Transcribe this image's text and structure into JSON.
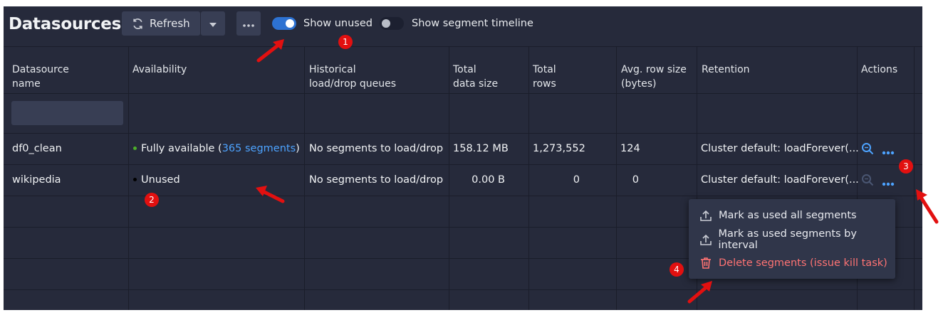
{
  "header": {
    "title": "Datasources",
    "refresh_label": "Refresh",
    "show_unused_label": "Show unused",
    "show_unused_on": true,
    "show_timeline_label": "Show segment timeline",
    "show_timeline_on": false
  },
  "table": {
    "columns": {
      "name_l1": "Datasource",
      "name_l2": "name",
      "availability": "Availability",
      "queues_l1": "Historical",
      "queues_l2": "load/drop queues",
      "size_l1": "Total",
      "size_l2": "data size",
      "rows_l1": "Total",
      "rows_l2": "rows",
      "avg_l1": "Avg. row size",
      "avg_l2": "(bytes)",
      "retention": "Retention",
      "actions": "Actions"
    },
    "rows": [
      {
        "name": "df0_clean",
        "availability_text": "Fully available (",
        "availability_link": "365 segments",
        "availability_end": ")",
        "status_color": "#4caf2a",
        "queues": "No segments to load/drop",
        "size": "158.12 MB",
        "rows": "1,273,552",
        "avg": "124",
        "retention": "Cluster default: loadForever(..."
      },
      {
        "name": "wikipedia",
        "availability_text": "Unused",
        "status_color": "#000000",
        "queues": "No segments to load/drop",
        "size": "0.00 B",
        "rows": "0",
        "avg": "0",
        "retention": "Cluster default: loadForever(..."
      }
    ]
  },
  "menu": {
    "items": [
      {
        "label": "Mark as used all segments",
        "icon": "upload-icon"
      },
      {
        "label": "Mark as used segments by interval",
        "icon": "upload-icon"
      },
      {
        "label": "Delete segments (issue kill task)",
        "icon": "trash-icon",
        "danger": true
      }
    ]
  },
  "annotations": [
    "1",
    "2",
    "3",
    "4"
  ],
  "colors": {
    "background": "#262a3b",
    "accent": "#2d72d2",
    "link": "#4da3ff",
    "danger": "#ff7373",
    "annotation": "#e21010"
  }
}
